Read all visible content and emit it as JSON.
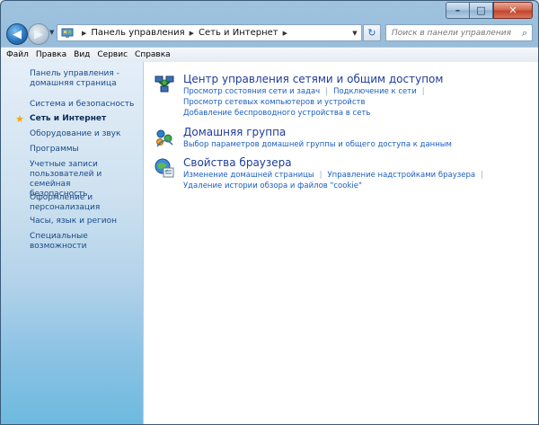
{
  "window": {
    "minimize_label": "–",
    "maximize_label": "□",
    "close_label": "✕"
  },
  "nav": {
    "back_label": "◀",
    "forward_label": "▶",
    "breadcrumb": [
      "Панель управления",
      "Сеть и Интернет"
    ],
    "refresh_label": "↻",
    "search_placeholder": "Поиск в панели управления"
  },
  "menu": [
    "Файл",
    "Правка",
    "Вид",
    "Сервис",
    "Справка"
  ],
  "sidebar": {
    "home": [
      "Панель управления -",
      "домашняя страница"
    ],
    "items": [
      {
        "label": "Система и безопасность"
      },
      {
        "label": "Сеть и Интернет",
        "active": true
      },
      {
        "label": "Оборудование и звук"
      },
      {
        "label": "Программы"
      },
      {
        "label": "Учетные записи\nпользователей и семейная\nбезопасность"
      },
      {
        "label": "Оформление и\nперсонализация"
      },
      {
        "label": "Часы, язык и регион"
      },
      {
        "label": "Специальные возможности"
      }
    ]
  },
  "categories": [
    {
      "title": "Центр управления сетями и общим доступом",
      "icon": "network-center-icon",
      "link_rows": [
        [
          "Просмотр состояния сети и задач",
          "Подключение к сети"
        ],
        [
          "Просмотр сетевых компьютеров и устройств"
        ],
        [
          "Добавление беспроводного устройства в сеть"
        ]
      ]
    },
    {
      "title": "Домашняя группа",
      "icon": "homegroup-icon",
      "link_rows": [
        [
          "Выбор параметров домашней группы и общего доступа к данным"
        ]
      ]
    },
    {
      "title": "Свойства браузера",
      "icon": "internet-options-icon",
      "link_rows": [
        [
          "Изменение домашней страницы",
          "Управление надстройками браузера"
        ],
        [
          "Удаление истории обзора и файлов \"cookie\""
        ]
      ]
    }
  ]
}
